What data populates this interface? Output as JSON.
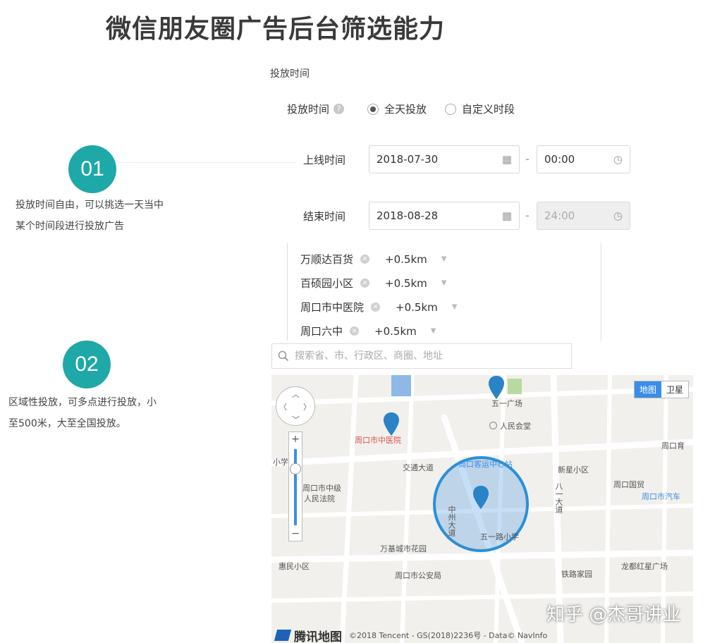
{
  "title": "微信朋友圈广告后台筛选能力",
  "section_label": "投放时间",
  "schedule": {
    "label": "投放时间",
    "help_icon": "?",
    "option_all_day": "全天投放",
    "option_custom": "自定义时段",
    "selected": "全天投放"
  },
  "start": {
    "label": "上线时间",
    "date": "2018-07-30",
    "time": "00:00"
  },
  "end": {
    "label": "结束时间",
    "date": "2018-08-28",
    "time": "24:00"
  },
  "range_separator": "-",
  "step1": {
    "number": "01",
    "desc_line1": "投放时间自由，可以挑选一天当中",
    "desc_line2": "某个时间段进行投放广告"
  },
  "step2": {
    "number": "02",
    "desc_line1": "区域性投放，可多点进行投放，小",
    "desc_line2": "至500米，大至全国投放。"
  },
  "locations": [
    {
      "name": "万顺达百货",
      "radius": "+0.5km"
    },
    {
      "name": "百硕园小区",
      "radius": "+0.5km"
    },
    {
      "name": "周口市中医院",
      "radius": "+0.5km"
    },
    {
      "name": "周口六中",
      "radius": "+0.5km"
    }
  ],
  "search": {
    "placeholder": "搜索省、市、行政区、商圈、地址"
  },
  "map": {
    "type_map": "地图",
    "type_satellite": "卫星",
    "pois": {
      "wuyi_square": "五一广场",
      "peoples_hall": "人民会堂",
      "zhoukou_1": "周口育",
      "tcm_hospital": "周口市中医院",
      "jiaotong_road": "交通大道",
      "passenger_center": "周口客运中心站",
      "xinxing": "新星小区",
      "guomao": "周口国贸",
      "bus_station": "周口市汽车",
      "court_1": "周口市中级",
      "court_2": "人民法院",
      "zhongzhou_road": "中州大道",
      "bayi_road": "八一大道",
      "wuyi_road": "五一路小学",
      "wanji": "万基城市花园",
      "huimin": "惠民小区",
      "police": "周口市公安局",
      "tielu": "铁路家园",
      "longdu": "龙都红星广场",
      "xiao": "小学"
    },
    "footer_brand": "腾讯地图",
    "footer_text": "©2018 Tencent - GS(2018)2236号 - Data© NavInfo"
  },
  "watermark": "知乎 @杰哥讲业"
}
